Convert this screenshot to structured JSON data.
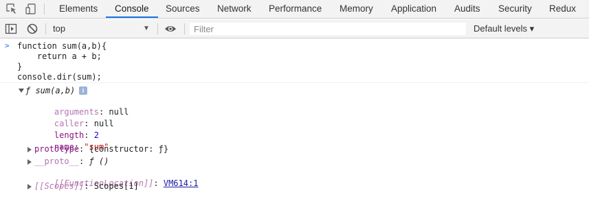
{
  "tabs": [
    "Elements",
    "Console",
    "Sources",
    "Network",
    "Performance",
    "Memory",
    "Application",
    "Audits",
    "Security",
    "Redux"
  ],
  "active_tab": "Console",
  "accent": "#1a73e8",
  "toolbar": {
    "context": "top",
    "filter_placeholder": "Filter",
    "levels": "Default levels ▾"
  },
  "input": {
    "prompt": ">",
    "lines": [
      "function sum(a,b){",
      "    return a + b;",
      "}",
      "console.dir(sum);"
    ]
  },
  "output": {
    "signature": "ƒ sum(a,b)",
    "info": "i",
    "props": [
      {
        "key": "arguments",
        "sep": ": ",
        "value": "null"
      },
      {
        "key": "caller",
        "sep": ": ",
        "value": "null"
      },
      {
        "key": "length",
        "sep": ": ",
        "value": "2"
      },
      {
        "key": "name",
        "sep": ": ",
        "value": "\"sum\""
      },
      {
        "key": "prototype",
        "sep": ": ",
        "value": "{constructor: ƒ}"
      },
      {
        "key": "__proto__",
        "sep": ": ",
        "value": "ƒ ()"
      },
      {
        "key": "[[FunctionLocation]]",
        "sep": ": ",
        "value": "VM614:1"
      },
      {
        "key": "[[Scopes]]",
        "sep": ": ",
        "value": "Scopes[1]"
      }
    ]
  }
}
